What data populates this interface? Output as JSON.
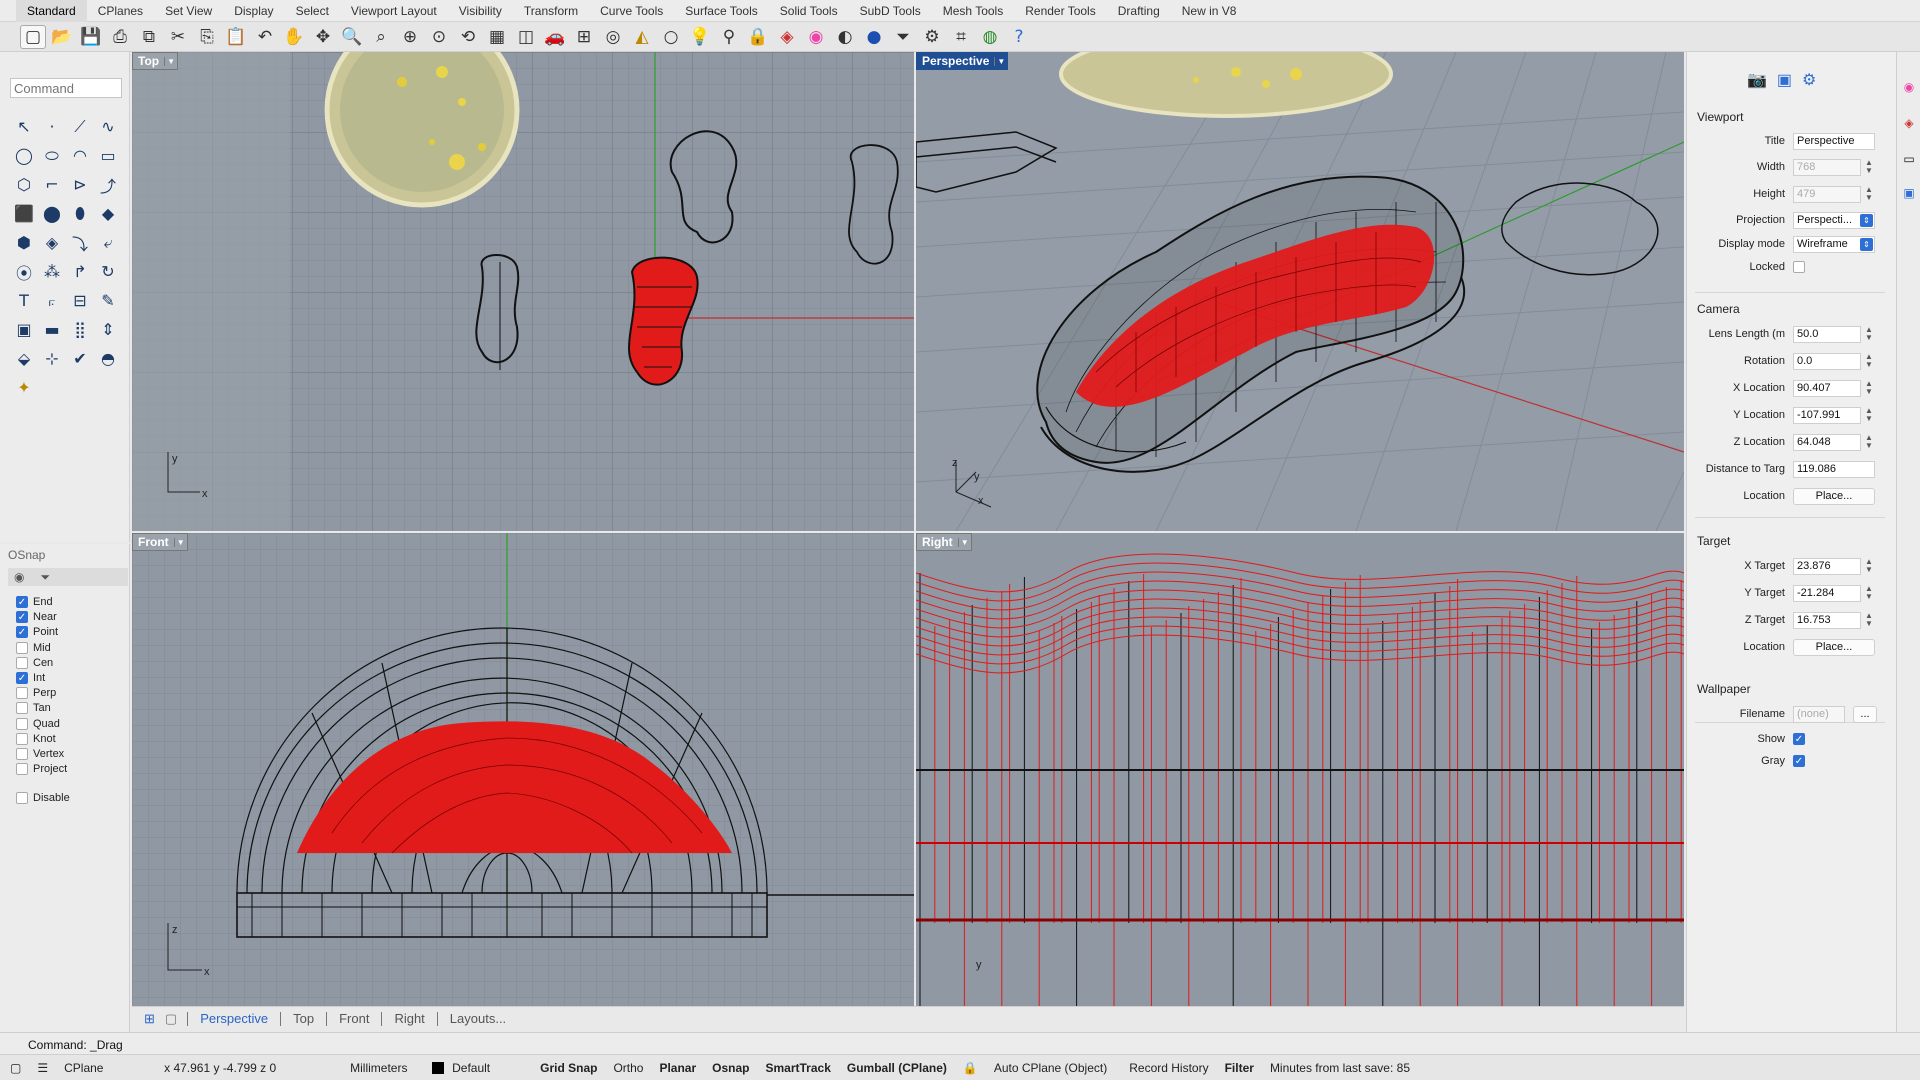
{
  "tabs": [
    "Standard",
    "CPlanes",
    "Set View",
    "Display",
    "Select",
    "Viewport Layout",
    "Visibility",
    "Transform",
    "Curve Tools",
    "Surface Tools",
    "Solid Tools",
    "SubD Tools",
    "Mesh Tools",
    "Render Tools",
    "Drafting",
    "New in V8"
  ],
  "toolbar_icons": [
    "new-file-icon",
    "open-file-icon",
    "save-icon",
    "print-icon",
    "import-icon",
    "cut-icon",
    "copy-icon",
    "paste-icon",
    "undo-icon",
    "pan-hand-icon",
    "move-icon",
    "zoom-icon",
    "zoom-window-icon",
    "zoom-extents-icon",
    "zoom-selected-icon",
    "rotate-view-icon",
    "four-viewports-icon",
    "layout-icon",
    "car-icon",
    "grid-icon",
    "wireframe-icon",
    "shade-icon",
    "sphere-icon",
    "render-icon",
    "bulb-icon",
    "lock-icon",
    "layers-icon",
    "color-wheel-icon",
    "material-icon",
    "sphere-blue-icon",
    "filter-icon",
    "options-gear-icon",
    "grid-snap-icon",
    "globe-icon",
    "help-icon"
  ],
  "command_placeholder": "Command",
  "osnap": {
    "title": "OSnap",
    "items": [
      {
        "label": "End",
        "checked": true
      },
      {
        "label": "Near",
        "checked": true
      },
      {
        "label": "Point",
        "checked": true
      },
      {
        "label": "Mid",
        "checked": false
      },
      {
        "label": "Cen",
        "checked": false
      },
      {
        "label": "Int",
        "checked": true
      },
      {
        "label": "Perp",
        "checked": false
      },
      {
        "label": "Tan",
        "checked": false
      },
      {
        "label": "Quad",
        "checked": false
      },
      {
        "label": "Knot",
        "checked": false
      },
      {
        "label": "Vertex",
        "checked": false
      },
      {
        "label": "Project",
        "checked": false
      }
    ],
    "disable_label": "Disable"
  },
  "viewports": {
    "top": "Top",
    "perspective": "Perspective",
    "front": "Front",
    "right": "Right"
  },
  "axis_labels": {
    "x": "x",
    "y": "y",
    "z": "z"
  },
  "viewport_tabs": [
    "Perspective",
    "Top",
    "Front",
    "Right",
    "Layouts..."
  ],
  "properties": {
    "viewport_heading": "Viewport",
    "title_label": "Title",
    "title_value": "Perspective",
    "width_label": "Width",
    "width_value": "768",
    "height_label": "Height",
    "height_value": "479",
    "projection_label": "Projection",
    "projection_value": "Perspecti...",
    "display_mode_label": "Display mode",
    "display_mode_value": "Wireframe",
    "locked_label": "Locked",
    "camera_heading": "Camera",
    "lens_label": "Lens Length (m",
    "lens_value": "50.0",
    "rotation_label": "Rotation",
    "rotation_value": "0.0",
    "xloc_label": "X Location",
    "xloc_value": "90.407",
    "yloc_label": "Y Location",
    "yloc_value": "-107.991",
    "zloc_label": "Z Location",
    "zloc_value": "64.048",
    "dist_label": "Distance to Targ",
    "dist_value": "119.086",
    "location_label": "Location",
    "place_label": "Place...",
    "target_heading": "Target",
    "xt_label": "X Target",
    "xt_value": "23.876",
    "yt_label": "Y Target",
    "yt_value": "-21.284",
    "zt_label": "Z Target",
    "zt_value": "16.753",
    "tloc_label": "Location",
    "tplace_label": "Place...",
    "wallpaper_heading": "Wallpaper",
    "filename_label": "Filename",
    "filename_value": "(none)",
    "browse_label": "...",
    "show_label": "Show",
    "gray_label": "Gray"
  },
  "command_line": "Command: _Drag",
  "status": {
    "cplane": "CPlane",
    "coords": "x 47.961   y -4.799   z 0",
    "units": "Millimeters",
    "layer": "Default",
    "grid_snap": "Grid Snap",
    "ortho": "Ortho",
    "planar": "Planar",
    "osnap": "Osnap",
    "smarttrack": "SmartTrack",
    "gumball": "Gumball (CPlane)",
    "auto_cplane": "Auto CPlane (Object)",
    "record_history": "Record History",
    "filter": "Filter",
    "minutes": "Minutes from last save: 85"
  },
  "colors": {
    "accent": "#2e6fd6",
    "viewport_bg": "#8f98a3",
    "wire_red": "#e11a1a",
    "active_label": "#1f4e93"
  }
}
